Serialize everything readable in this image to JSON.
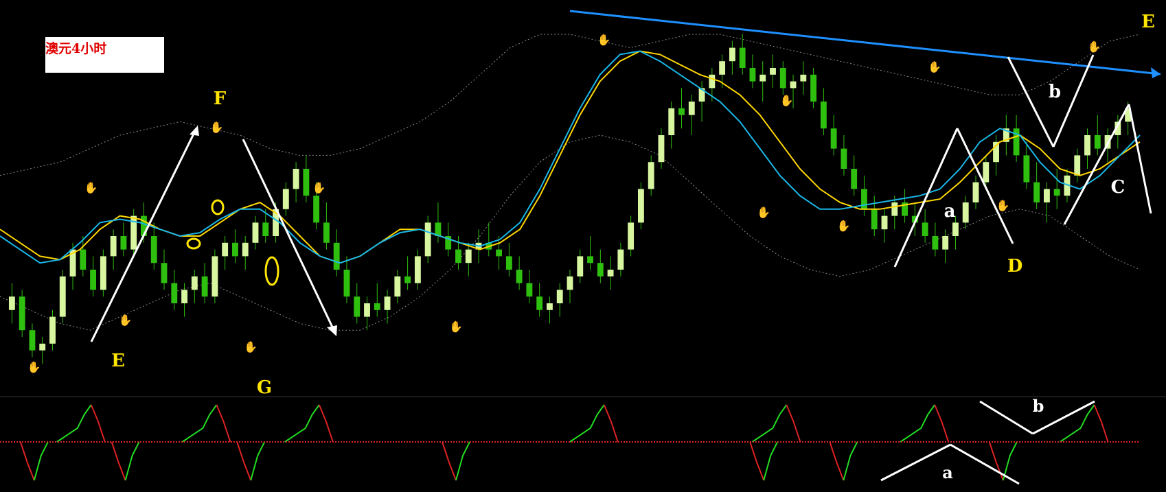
{
  "title": "澳元4小时",
  "colors": {
    "background": "#000000",
    "bull_candle": "#d8f5a0",
    "bear_candle": "#2fbf0f",
    "ma_yellow": "#ffd700",
    "ma_cyan": "#19b8e8",
    "band": "#8a8a8a",
    "trendline": "#1e90ff",
    "annotation_yellow": "#ffe600",
    "annotation_white": "#ffffff",
    "fractal_up": "#cc2222",
    "fractal_down": "#3399ff",
    "osc_up": "#22dd22",
    "osc_down": "#dd2222"
  },
  "annotations": {
    "yellow_labels": [
      "F",
      "E",
      "G",
      "D",
      "E"
    ],
    "white_labels": [
      "a",
      "b",
      "C"
    ],
    "osc_labels": [
      "a",
      "b"
    ]
  },
  "chart_data": {
    "type": "candlestick",
    "title": "澳元4小时",
    "candles": [
      [
        18,
        26,
        14,
        22
      ],
      [
        22,
        24,
        10,
        12
      ],
      [
        12,
        14,
        4,
        6
      ],
      [
        6,
        10,
        2,
        8
      ],
      [
        8,
        18,
        6,
        16
      ],
      [
        16,
        30,
        14,
        28
      ],
      [
        28,
        38,
        24,
        36
      ],
      [
        36,
        40,
        28,
        30
      ],
      [
        30,
        34,
        22,
        24
      ],
      [
        24,
        36,
        22,
        34
      ],
      [
        34,
        42,
        30,
        40
      ],
      [
        40,
        44,
        34,
        36
      ],
      [
        36,
        48,
        34,
        46
      ],
      [
        46,
        50,
        38,
        40
      ],
      [
        40,
        44,
        30,
        32
      ],
      [
        32,
        36,
        24,
        26
      ],
      [
        26,
        30,
        18,
        20
      ],
      [
        20,
        26,
        16,
        24
      ],
      [
        24,
        30,
        20,
        28
      ],
      [
        28,
        32,
        20,
        22
      ],
      [
        22,
        36,
        20,
        34
      ],
      [
        34,
        40,
        30,
        38
      ],
      [
        38,
        42,
        32,
        34
      ],
      [
        34,
        40,
        30,
        38
      ],
      [
        38,
        46,
        36,
        44
      ],
      [
        44,
        48,
        38,
        40
      ],
      [
        40,
        50,
        38,
        48
      ],
      [
        48,
        56,
        46,
        54
      ],
      [
        54,
        62,
        50,
        60
      ],
      [
        60,
        64,
        50,
        52
      ],
      [
        52,
        56,
        42,
        44
      ],
      [
        44,
        50,
        36,
        38
      ],
      [
        38,
        42,
        28,
        30
      ],
      [
        30,
        34,
        20,
        22
      ],
      [
        22,
        26,
        14,
        16
      ],
      [
        16,
        22,
        12,
        20
      ],
      [
        20,
        26,
        16,
        18
      ],
      [
        18,
        24,
        14,
        22
      ],
      [
        22,
        30,
        20,
        28
      ],
      [
        28,
        34,
        24,
        26
      ],
      [
        26,
        36,
        24,
        34
      ],
      [
        34,
        46,
        32,
        44
      ],
      [
        44,
        50,
        38,
        40
      ],
      [
        40,
        44,
        34,
        36
      ],
      [
        36,
        40,
        30,
        32
      ],
      [
        32,
        38,
        28,
        36
      ],
      [
        36,
        42,
        32,
        38
      ],
      [
        38,
        44,
        34,
        36
      ],
      [
        36,
        40,
        30,
        34
      ],
      [
        34,
        38,
        28,
        30
      ],
      [
        30,
        34,
        24,
        26
      ],
      [
        26,
        30,
        20,
        22
      ],
      [
        22,
        26,
        16,
        18
      ],
      [
        18,
        22,
        14,
        20
      ],
      [
        20,
        26,
        16,
        24
      ],
      [
        24,
        30,
        20,
        28
      ],
      [
        28,
        36,
        26,
        34
      ],
      [
        34,
        40,
        30,
        32
      ],
      [
        32,
        36,
        26,
        28
      ],
      [
        28,
        34,
        24,
        30
      ],
      [
        30,
        38,
        28,
        36
      ],
      [
        36,
        46,
        34,
        44
      ],
      [
        44,
        56,
        42,
        54
      ],
      [
        54,
        64,
        52,
        62
      ],
      [
        62,
        72,
        60,
        70
      ],
      [
        70,
        80,
        66,
        78
      ],
      [
        78,
        84,
        72,
        76
      ],
      [
        76,
        82,
        70,
        80
      ],
      [
        80,
        86,
        74,
        84
      ],
      [
        84,
        90,
        80,
        88
      ],
      [
        88,
        94,
        84,
        92
      ],
      [
        92,
        98,
        88,
        96
      ],
      [
        96,
        100,
        88,
        90
      ],
      [
        90,
        94,
        84,
        86
      ],
      [
        86,
        92,
        80,
        88
      ],
      [
        88,
        94,
        84,
        90
      ],
      [
        90,
        92,
        82,
        84
      ],
      [
        84,
        88,
        78,
        86
      ],
      [
        86,
        92,
        82,
        88
      ],
      [
        88,
        90,
        78,
        80
      ],
      [
        80,
        84,
        70,
        72
      ],
      [
        72,
        76,
        64,
        66
      ],
      [
        66,
        70,
        58,
        60
      ],
      [
        60,
        64,
        52,
        54
      ],
      [
        54,
        58,
        46,
        48
      ],
      [
        48,
        52,
        40,
        42
      ],
      [
        42,
        48,
        38,
        46
      ],
      [
        46,
        52,
        42,
        50
      ],
      [
        50,
        54,
        44,
        46
      ],
      [
        46,
        50,
        40,
        44
      ],
      [
        44,
        48,
        38,
        40
      ],
      [
        40,
        44,
        34,
        36
      ],
      [
        36,
        42,
        32,
        40
      ],
      [
        40,
        46,
        36,
        44
      ],
      [
        44,
        52,
        42,
        50
      ],
      [
        50,
        58,
        48,
        56
      ],
      [
        56,
        64,
        54,
        62
      ],
      [
        62,
        70,
        58,
        68
      ],
      [
        68,
        76,
        64,
        72
      ],
      [
        72,
        76,
        62,
        64
      ],
      [
        64,
        68,
        54,
        56
      ],
      [
        56,
        62,
        48,
        50
      ],
      [
        50,
        56,
        44,
        54
      ],
      [
        54,
        60,
        48,
        52
      ],
      [
        52,
        60,
        50,
        58
      ],
      [
        58,
        66,
        56,
        64
      ],
      [
        64,
        72,
        60,
        70
      ],
      [
        70,
        76,
        64,
        66
      ],
      [
        66,
        72,
        62,
        70
      ],
      [
        70,
        76,
        66,
        74
      ],
      [
        74,
        80,
        70,
        78
      ]
    ],
    "ma_yellow": [
      42,
      38,
      34,
      33,
      36,
      42,
      46,
      45,
      42,
      40,
      40,
      44,
      48,
      50,
      46,
      40,
      34,
      32,
      34,
      38,
      42,
      42,
      40,
      38,
      36,
      38,
      42,
      52,
      64,
      76,
      86,
      92,
      95,
      94,
      91,
      88,
      86,
      82,
      76,
      68,
      60,
      54,
      50,
      48,
      48,
      49,
      50,
      51,
      56,
      62,
      68,
      70,
      66,
      60,
      58,
      60,
      64,
      68
    ],
    "ma_cyan": [
      40,
      36,
      32,
      33,
      38,
      44,
      45,
      44,
      42,
      40,
      41,
      45,
      48,
      48,
      44,
      38,
      34,
      32,
      34,
      38,
      41,
      42,
      40,
      38,
      37,
      39,
      44,
      54,
      66,
      78,
      88,
      94,
      95,
      92,
      88,
      84,
      80,
      74,
      66,
      58,
      52,
      48,
      48,
      49,
      50,
      51,
      52,
      54,
      60,
      68,
      72,
      70,
      62,
      56,
      54,
      58,
      64,
      70
    ],
    "band_upper": [
      58,
      60,
      62,
      66,
      70,
      72,
      74,
      72,
      70,
      66,
      64,
      64,
      66,
      70,
      74,
      80,
      88,
      96,
      100,
      100,
      98,
      96,
      98,
      100,
      100,
      98,
      96,
      94,
      92,
      90,
      88,
      86,
      84,
      82,
      82,
      86,
      92,
      98,
      100
    ],
    "band_lower": [
      22,
      18,
      14,
      12,
      16,
      20,
      24,
      26,
      22,
      18,
      14,
      12,
      12,
      16,
      22,
      30,
      40,
      52,
      62,
      68,
      70,
      68,
      64,
      56,
      48,
      40,
      34,
      30,
      28,
      30,
      34,
      38,
      42,
      46,
      48,
      46,
      40,
      34,
      30
    ],
    "fractals_up": [
      [
        0.08,
        52
      ],
      [
        0.19,
        70
      ],
      [
        0.28,
        52
      ],
      [
        0.53,
        96
      ],
      [
        0.69,
        78
      ],
      [
        0.82,
        88
      ],
      [
        0.96,
        94
      ]
    ],
    "fractals_down": [
      [
        0.03,
        4
      ],
      [
        0.11,
        18
      ],
      [
        0.22,
        10
      ],
      [
        0.4,
        16
      ],
      [
        0.67,
        50
      ],
      [
        0.74,
        46
      ],
      [
        0.88,
        52
      ]
    ],
    "oscillator": {
      "levels": "binary",
      "peaks": [
        0.08,
        0.19,
        0.28,
        0.53,
        0.69,
        0.82,
        0.96
      ],
      "troughs": [
        0.03,
        0.11,
        0.22,
        0.4,
        0.67,
        0.74,
        0.88
      ]
    },
    "trendline": {
      "from": [
        0.49,
        100
      ],
      "to": [
        1.0,
        86
      ]
    }
  }
}
